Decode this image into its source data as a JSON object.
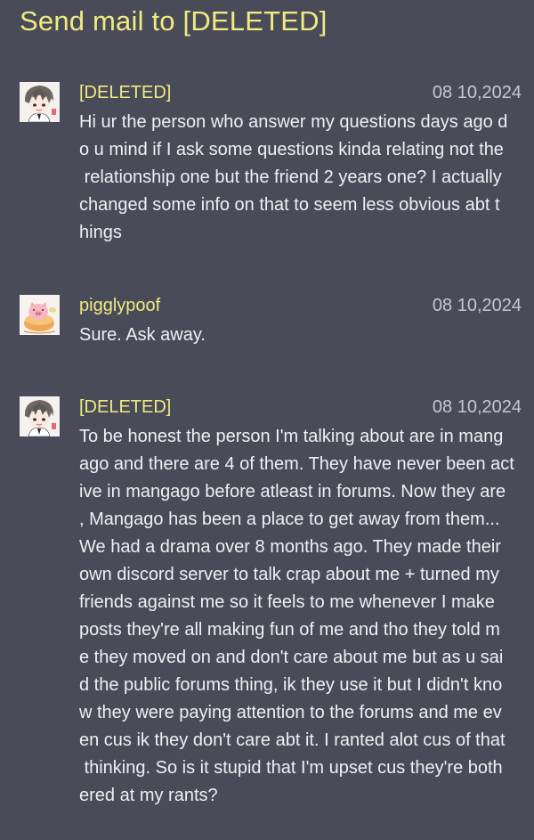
{
  "page": {
    "title": "Send mail to [DELETED]"
  },
  "colors": {
    "background": "#494b59",
    "accent": "#efeb7f",
    "text": "#eef0f4",
    "date": "#c6c7cf"
  },
  "messages": [
    {
      "sender": "[DELETED]",
      "avatar_icon": "anime-boy-avatar-icon",
      "date": "08 10,2024",
      "text": "Hi ur the person who answer my questions days ago d\no u mind if I ask some questions kinda relating not the\n relationship one but the friend 2 years one? I actually\nchanged some info on that to seem less obvious abt t\nhings"
    },
    {
      "sender": "pigglypoof",
      "avatar_icon": "pig-pudding-avatar-icon",
      "date": "08 10,2024",
      "text": "Sure. Ask away."
    },
    {
      "sender": "[DELETED]",
      "avatar_icon": "anime-boy-avatar-icon",
      "date": "08 10,2024",
      "text": "To be honest the person I'm talking about are in mang\nago and there are 4 of them. They have never been act\nive in mangago before atleast in forums. Now they are\n, Mangago has been a place to get away from them...\nWe had a drama over 8 months ago. They made their\nown discord server to talk crap about me + turned my\nfriends against me so it feels to me whenever I make\nposts they're all making fun of me and tho they told m\ne they moved on and don't care about me but as u sai\nd the public forums thing, ik they use it but I didn't kno\nw they were paying attention to the forums and me ev\nen cus ik they don't care abt it. I ranted alot cus of that\n thinking. So is it stupid that I'm upset cus they're both\nered at my rants?"
    }
  ]
}
